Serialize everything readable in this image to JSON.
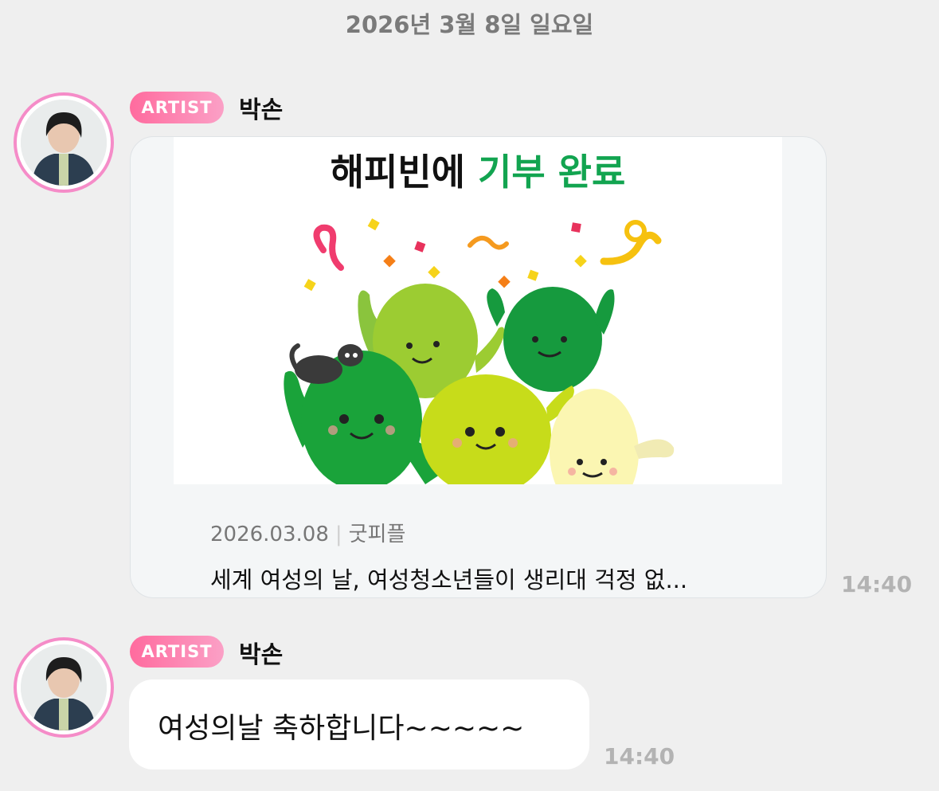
{
  "date_divider": "2026년 3월 8일 일요일",
  "messages": [
    {
      "badge": "ARTIST",
      "sender": "박손",
      "link_card": {
        "headline_black": "해피빈에",
        "headline_green": "기부 완료",
        "date": "2026.03.08",
        "source": "굿피플",
        "title": "세계 여성의 날, 여성청소년들이 생리대 걱정 없..."
      },
      "time": "14:40"
    },
    {
      "badge": "ARTIST",
      "sender": "박손",
      "text": "여성의날 축하합니다~~~~~",
      "time": "14:40"
    }
  ],
  "colors": {
    "background": "#efefef",
    "badge_gradient_start": "#ff6b9e",
    "badge_gradient_end": "#fba0c6",
    "avatar_ring": "#f58cc8",
    "headline_green": "#12a450",
    "timestamp": "#b3b3b3"
  }
}
